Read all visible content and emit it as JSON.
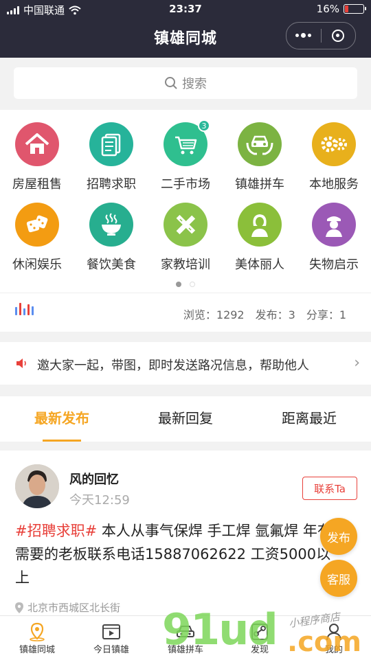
{
  "status": {
    "carrier": "中国联通",
    "time": "23:37",
    "battery": "16%"
  },
  "nav": {
    "title": "镇雄同城"
  },
  "search": {
    "placeholder": "搜索"
  },
  "categories": [
    {
      "label": "房屋租售",
      "color": "#e0566d",
      "icon": "house-icon"
    },
    {
      "label": "招聘求职",
      "color": "#26b39a",
      "icon": "documents-icon"
    },
    {
      "label": "二手市场",
      "color": "#2fbf8f",
      "icon": "cart-icon",
      "badge": "3"
    },
    {
      "label": "镇雄拼车",
      "color": "#7cb342",
      "icon": "car-hands-icon"
    },
    {
      "label": "本地服务",
      "color": "#e8b01c",
      "icon": "gears-icon"
    },
    {
      "label": "休闲娱乐",
      "color": "#f39c12",
      "icon": "dice-icon"
    },
    {
      "label": "餐饮美食",
      "color": "#27ae8f",
      "icon": "bowl-icon"
    },
    {
      "label": "家教培训",
      "color": "#8bc34a",
      "icon": "ruler-pencil-icon"
    },
    {
      "label": "美体丽人",
      "color": "#8bbf3a",
      "icon": "woman-icon"
    },
    {
      "label": "失物启示",
      "color": "#9b59b6",
      "icon": "officer-icon"
    }
  ],
  "stats": {
    "views": "浏览：1292",
    "posts": "发布：3",
    "shares": "分享：1"
  },
  "notice": {
    "text": "邀大家一起，带图，即时发送路况信息，帮助他人"
  },
  "tabs": [
    {
      "label": "最新发布",
      "active": true
    },
    {
      "label": "最新回复",
      "active": false
    },
    {
      "label": "距离最近",
      "active": false
    }
  ],
  "post": {
    "author": "风的回忆",
    "time": "今天12:59",
    "contact": "联系Ta",
    "tag": "#招聘求职#",
    "body": " 本人从事气保焊 手工焊 氩氟焊 年有需要的老板联系电话15887062622 工资5000以上",
    "location": "北京市西城区北长街"
  },
  "fab": {
    "publish": "发布",
    "service": "客服"
  },
  "bottom_nav": [
    {
      "label": "镇雄同城",
      "icon": "location-pin-icon"
    },
    {
      "label": "今日镇雄",
      "icon": "video-play-icon"
    },
    {
      "label": "镇雄拼车",
      "icon": "car-icon"
    },
    {
      "label": "发现",
      "icon": "link-icon"
    },
    {
      "label": "我的",
      "icon": "user-icon"
    }
  ],
  "watermark": {
    "main": "91ud",
    "domain": ".com",
    "tagline": "小程序商店"
  }
}
